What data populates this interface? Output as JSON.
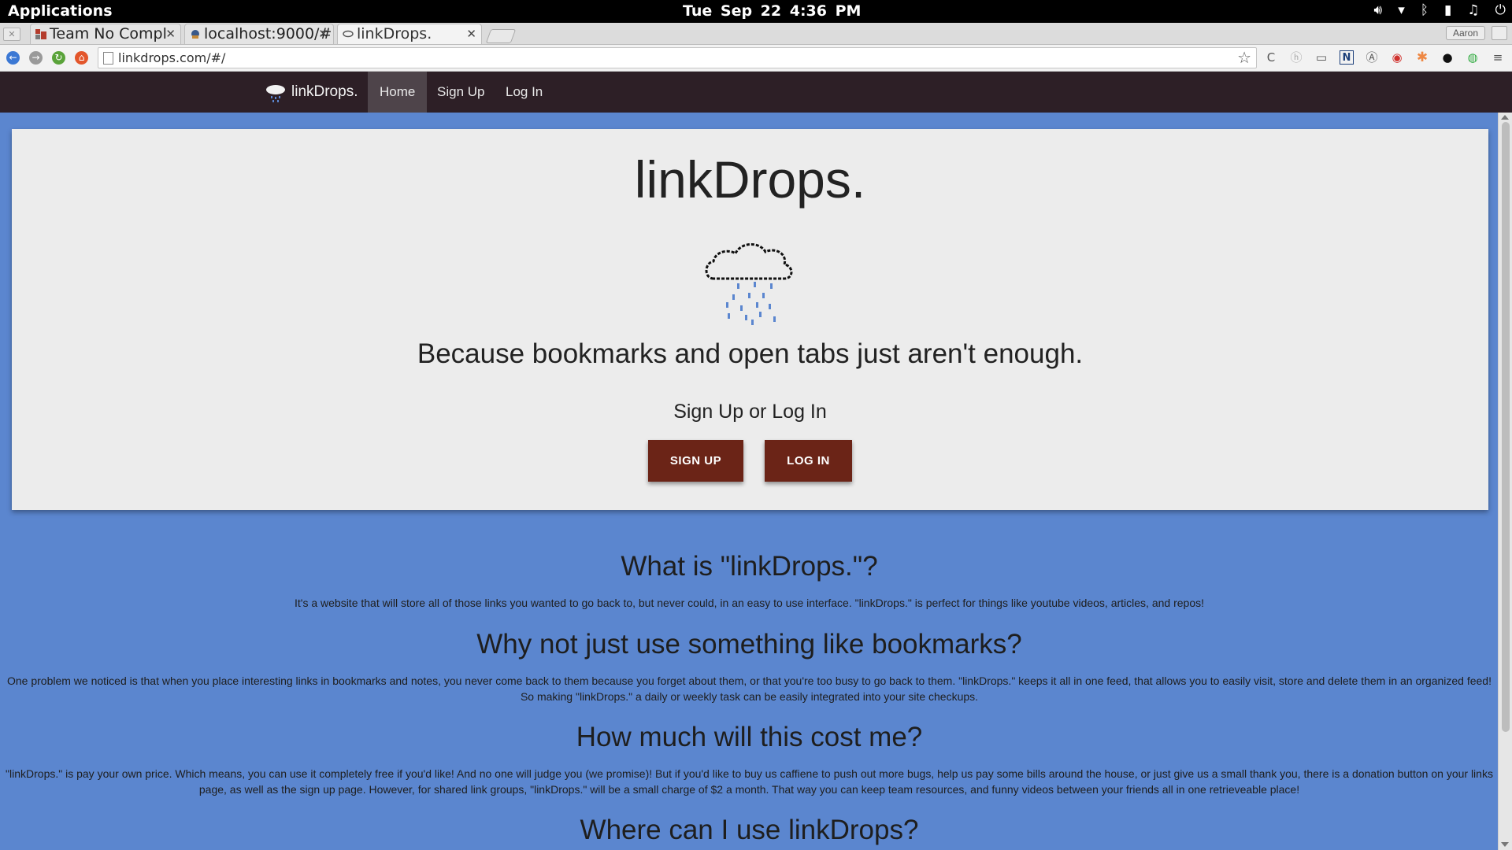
{
  "system_bar": {
    "applications": "Applications",
    "clock": "Tue Sep 22   4:36 PM"
  },
  "browser": {
    "tabs": [
      {
        "label": "Team No Compl"
      },
      {
        "label": "localhost:9000/#"
      },
      {
        "label": "linkDrops."
      }
    ],
    "profile": "Aaron",
    "url": "linkdrops.com/#/"
  },
  "site": {
    "brand": "linkDrops.",
    "nav": [
      "Home",
      "Sign Up",
      "Log In"
    ]
  },
  "hero": {
    "title": "linkDrops.",
    "tagline": "Because bookmarks and open tabs just aren't enough.",
    "cta_text": "Sign Up or Log In",
    "signup_button": "SIGN UP",
    "login_button": "LOG IN"
  },
  "sections": [
    {
      "heading": "What is \"linkDrops.\"?",
      "body": "It's a website that will store all of those links you wanted to go back to, but never could, in an easy to use interface. \"linkDrops.\" is perfect for things like youtube videos, articles, and repos!"
    },
    {
      "heading": "Why not just use something like bookmarks?",
      "body": "One problem we noticed is that when you place interesting links in bookmarks and notes, you never come back to them because you forget about them, or that you're too busy to go back to them. \"linkDrops.\" keeps it all in one feed, that allows you to easily visit, store and delete them in an organized feed! So making \"linkDrops.\" a daily or weekly task can be easily integrated into your site checkups."
    },
    {
      "heading": "How much will this cost me?",
      "body": "\"linkDrops.\" is pay your own price. Which means, you can use it completely free if you'd like! And no one will judge you (we promise)! But if you'd like to buy us caffiene to push out more bugs, help us pay some bills around the house, or just give us a small thank you, there is a donation button on your links page, as well as the sign up page. However, for shared link groups, \"linkDrops.\" will be a small charge of $2 a month. That way you can keep team resources, and funny videos between your friends all in one retrieveable place!"
    },
    {
      "heading": "Where can I use linkDrops?",
      "body": ""
    }
  ],
  "colors": {
    "page_bg": "#5b86cf",
    "navbar_bg": "#2d1f26",
    "button_bg": "#6b2417",
    "hero_bg": "#ececec",
    "rain": "#5b86cf"
  }
}
